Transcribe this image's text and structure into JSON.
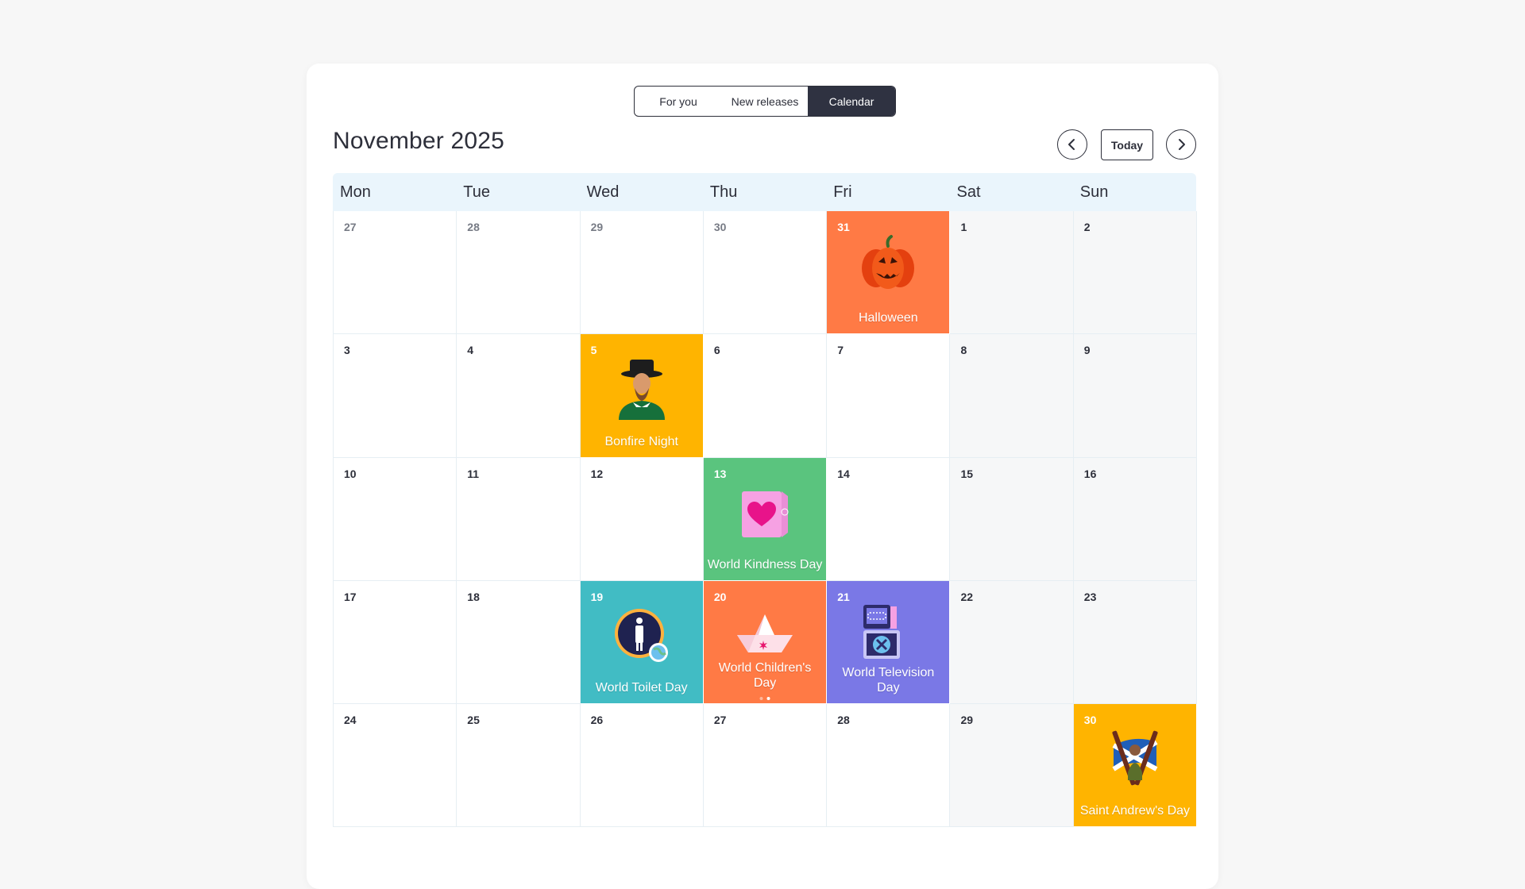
{
  "tabs": [
    {
      "label": "For you",
      "active": false
    },
    {
      "label": "New releases",
      "active": false
    },
    {
      "label": "Calendar",
      "active": true
    }
  ],
  "header": {
    "month_title": "November 2025",
    "today_label": "Today"
  },
  "weekdays": [
    "Mon",
    "Tue",
    "Wed",
    "Thu",
    "Fri",
    "Sat",
    "Sun"
  ],
  "colors": {
    "orange": "#ff7a45",
    "yellow": "#ffb400",
    "green": "#5ac47e",
    "teal": "#41bcc4",
    "purple": "#7a78e6",
    "header_bg": "#eaf5fc",
    "active_tab": "#2f3241"
  },
  "weeks": [
    [
      {
        "day": "27",
        "other": true
      },
      {
        "day": "28",
        "other": true
      },
      {
        "day": "29",
        "other": true
      },
      {
        "day": "30",
        "other": true
      },
      {
        "day": "31",
        "other": true,
        "event": {
          "label": "Halloween",
          "color": "#ff7a45",
          "icon": "pumpkin-icon"
        }
      },
      {
        "day": "1"
      },
      {
        "day": "2"
      }
    ],
    [
      {
        "day": "3"
      },
      {
        "day": "4"
      },
      {
        "day": "5",
        "event": {
          "label": "Bonfire Night",
          "color": "#ffb400",
          "icon": "guy-fawkes-icon"
        }
      },
      {
        "day": "6"
      },
      {
        "day": "7"
      },
      {
        "day": "8"
      },
      {
        "day": "9"
      }
    ],
    [
      {
        "day": "10"
      },
      {
        "day": "11"
      },
      {
        "day": "12"
      },
      {
        "day": "13",
        "event": {
          "label": "World Kindness Day",
          "color": "#5ac47e",
          "icon": "heart-box-icon"
        }
      },
      {
        "day": "14"
      },
      {
        "day": "15"
      },
      {
        "day": "16"
      }
    ],
    [
      {
        "day": "17"
      },
      {
        "day": "18"
      },
      {
        "day": "19",
        "event": {
          "label": "World Toilet Day",
          "color": "#41bcc4",
          "icon": "restroom-sign-icon"
        }
      },
      {
        "day": "20",
        "event": {
          "label": "World Children's Day",
          "color": "#ff7a45",
          "icon": "paper-boat-icon",
          "dots": 2
        }
      },
      {
        "day": "21",
        "event": {
          "label": "World Television Day",
          "color": "#7a78e6",
          "icon": "television-icon"
        }
      },
      {
        "day": "22"
      },
      {
        "day": "23"
      }
    ],
    [
      {
        "day": "24"
      },
      {
        "day": "25"
      },
      {
        "day": "26"
      },
      {
        "day": "27"
      },
      {
        "day": "28"
      },
      {
        "day": "29"
      },
      {
        "day": "30",
        "event": {
          "label": "Saint Andrew's Day",
          "color": "#ffb400",
          "icon": "saltire-flag-icon"
        }
      }
    ]
  ]
}
